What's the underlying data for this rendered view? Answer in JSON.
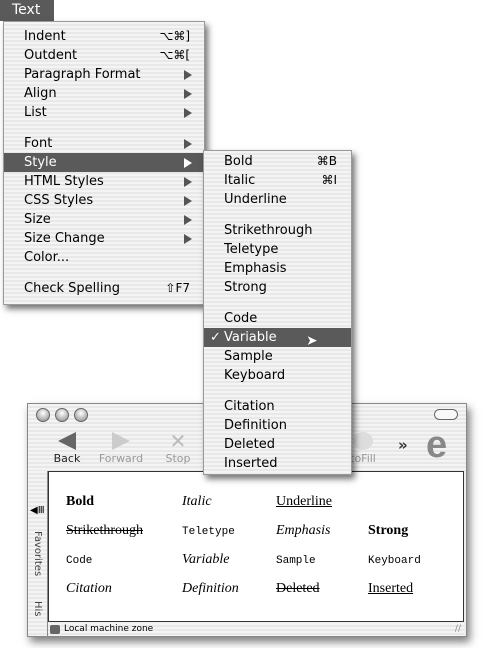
{
  "menubar": {
    "title": "Text"
  },
  "text_menu": {
    "items": [
      {
        "label": "Indent",
        "shortcut": "⌥⌘]"
      },
      {
        "label": "Outdent",
        "shortcut": "⌥⌘["
      },
      {
        "label": "Paragraph Format",
        "submenu": true
      },
      {
        "label": "Align",
        "submenu": true
      },
      {
        "label": "List",
        "submenu": true
      },
      {
        "label": "Font",
        "submenu": true
      },
      {
        "label": "Style",
        "submenu": true,
        "highlighted": true
      },
      {
        "label": "HTML Styles",
        "submenu": true
      },
      {
        "label": "CSS Styles",
        "submenu": true
      },
      {
        "label": "Size",
        "submenu": true
      },
      {
        "label": "Size Change",
        "submenu": true
      },
      {
        "label": "Color..."
      },
      {
        "label": "Check Spelling",
        "shortcut": "⇧F7"
      }
    ]
  },
  "style_menu": {
    "items": [
      {
        "label": "Bold",
        "shortcut": "⌘B"
      },
      {
        "label": "Italic",
        "shortcut": "⌘I"
      },
      {
        "label": "Underline"
      },
      {
        "label": "Strikethrough"
      },
      {
        "label": "Teletype"
      },
      {
        "label": "Emphasis"
      },
      {
        "label": "Strong"
      },
      {
        "label": "Code"
      },
      {
        "label": "Variable",
        "checked": true,
        "highlighted": true
      },
      {
        "label": "Sample"
      },
      {
        "label": "Keyboard"
      },
      {
        "label": "Citation"
      },
      {
        "label": "Definition"
      },
      {
        "label": "Deleted"
      },
      {
        "label": "Inserted"
      }
    ],
    "check": "✓"
  },
  "browser": {
    "toolbar": {
      "back": "Back",
      "forward": "Forward",
      "stop": "Stop",
      "autofill": "toFill",
      "more": "»",
      "logo": "e"
    },
    "sidebar": {
      "favorites": "Favorites",
      "history": "His"
    },
    "content": [
      [
        "Bold",
        "Italic",
        "Underline",
        ""
      ],
      [
        "Strikethrough",
        "Teletype",
        "Emphasis",
        "Strong"
      ],
      [
        "Code",
        "Variable",
        "Sample",
        "Keyboard"
      ],
      [
        "Citation",
        "Definition",
        "Deleted",
        "Inserted"
      ]
    ],
    "status": "Local machine zone"
  },
  "colors": {
    "highlight": "#5a5a5a"
  }
}
